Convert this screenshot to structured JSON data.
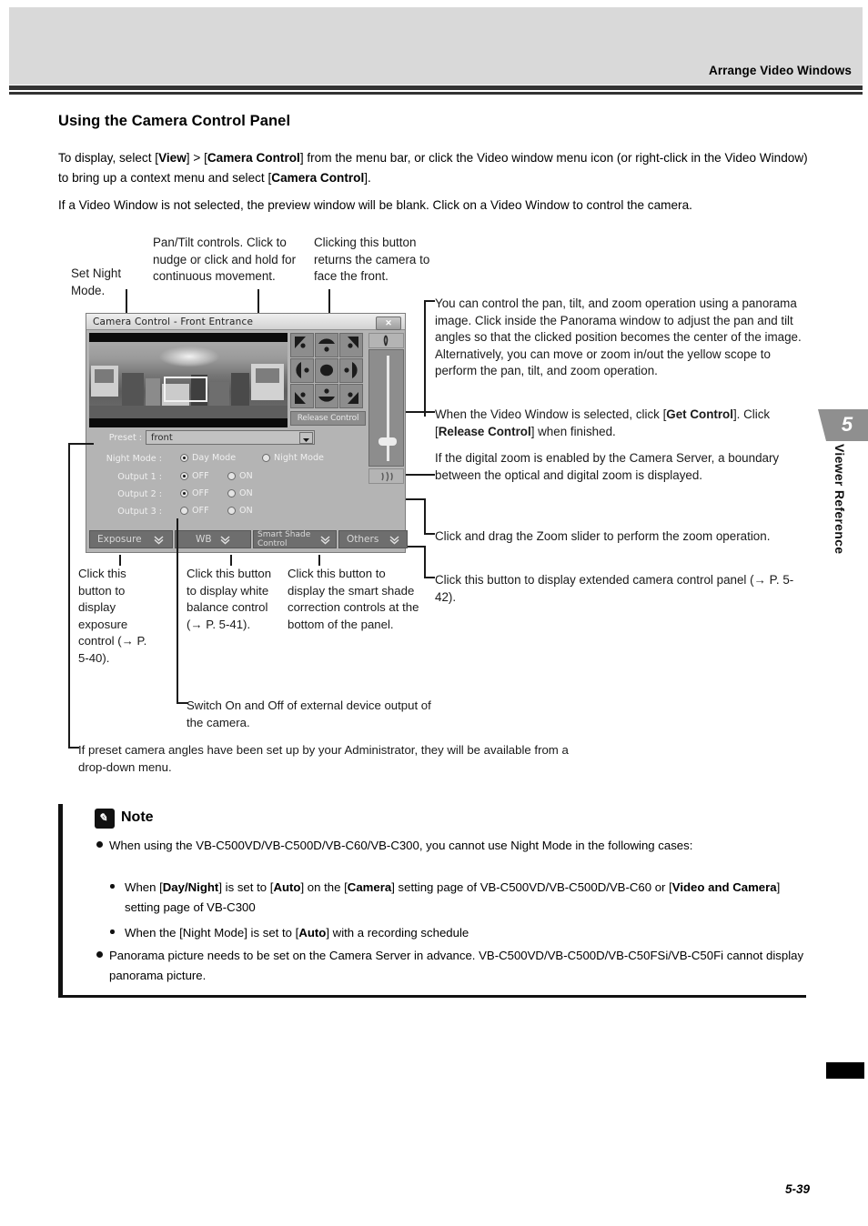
{
  "header": {
    "running_head": "Arrange Video Windows"
  },
  "section": {
    "title": "Using the Camera Control Panel",
    "para1_a": "To display, select [",
    "para1_view": "View",
    "para1_b": "] > [",
    "para1_cc": "Camera Control",
    "para1_c": "] from the menu bar, or click the Video window menu icon (or right-click in the Video Window) to bring up a context menu and select [",
    "para1_cc2": "Camera Control",
    "para1_d": "].",
    "para2": "If a Video Window is not selected, the preview window will be blank. Click on a Video Window to control the camera."
  },
  "annotations": {
    "set_night": "Set Night Mode.",
    "pan_tilt": "Pan/Tilt controls. Click to nudge or click and hold for continuous movement.",
    "return_front": "Clicking this button returns the camera to face the front.",
    "panorama": "You can control the pan, tilt, and zoom operation using a panorama image. Click inside the Panorama window to adjust the pan and tilt angles so that the clicked position becomes the center of the image. Alternatively, you can move or zoom in/out the yellow scope to perform the pan, tilt, and zoom operation.",
    "get_control_a": "When the Video Window is selected, click [",
    "get_control_b": "Get Control",
    "get_control_c": "]. Click [",
    "get_control_d": "Release Control",
    "get_control_e": "] when finished.",
    "digital_zoom": "If the digital zoom is enabled by the Camera Server, a boundary between the optical and digital zoom is displayed.",
    "zoom_slider": "Click and drag the Zoom slider to perform the zoom operation.",
    "extended_panel": "Click this button to display extended camera control panel (→ P. 5-42).",
    "exposure": "Click this button to display exposure control (→ P. 5-40).",
    "white_balance": "Click this button to display white balance control (→ P. 5-41).",
    "smart_shade": "Click this button to display the smart shade correction controls at the bottom of the panel.",
    "switch_output": "Switch On and Off of external device output of the camera.",
    "preset": "If preset camera angles have been set up by your Administrator, they will be available from a drop-down menu."
  },
  "dialog": {
    "title": "Camera Control - Front Entrance",
    "close_label": "✕",
    "release_control": "Release Control",
    "zoom_indicator": "ⓘ",
    "pad_buttons": [
      "pan-tilt-up-left",
      "pan-tilt-up",
      "pan-tilt-up-right",
      "pan-tilt-left",
      "pan-tilt-home",
      "pan-tilt-right",
      "pan-tilt-down-left",
      "pan-tilt-down",
      "pan-tilt-down-right"
    ],
    "fields": {
      "preset_label": "Preset :",
      "preset_value": "front",
      "night_mode_label": "Night Mode :",
      "day_mode": "Day Mode",
      "night_mode": "Night Mode",
      "output1_label": "Output 1 :",
      "output2_label": "Output 2 :",
      "output3_label": "Output 3 :",
      "off": "OFF",
      "on": "ON"
    },
    "buttons": {
      "exposure": "Exposure",
      "wb": "WB",
      "smart_shade_l1": "Smart Shade",
      "smart_shade_l2": "Control",
      "others": "Others",
      "chevron": "ˇˇ"
    }
  },
  "side_tab": {
    "number": "5",
    "label": "Viewer Reference"
  },
  "note": {
    "title": "Note",
    "icon_glyph": "✎",
    "item1": "When using the VB-C500VD/VB-C500D/VB-C60/VB-C300, you cannot use Night Mode in the following cases:",
    "sub1_a": "When [",
    "sub1_b": "Day/Night",
    "sub1_c": "] is set to [",
    "sub1_d": "Auto",
    "sub1_e": "] on the [",
    "sub1_f": "Camera",
    "sub1_g": "] setting page of VB-C500VD/VB-C500D/VB-C60 or [",
    "sub1_h": "Video and Camera",
    "sub1_i": "] setting page of VB-C300",
    "sub2_a": "When the [Night Mode] is set to [",
    "sub2_b": "Auto",
    "sub2_c": "] with a recording schedule",
    "item2": "Panorama picture needs to be set on the Camera Server in advance. VB-C500VD/VB-C500D/VB-C50FSi/VB-C50Fi cannot display panorama picture."
  },
  "footer": {
    "page_number": "5-39"
  }
}
